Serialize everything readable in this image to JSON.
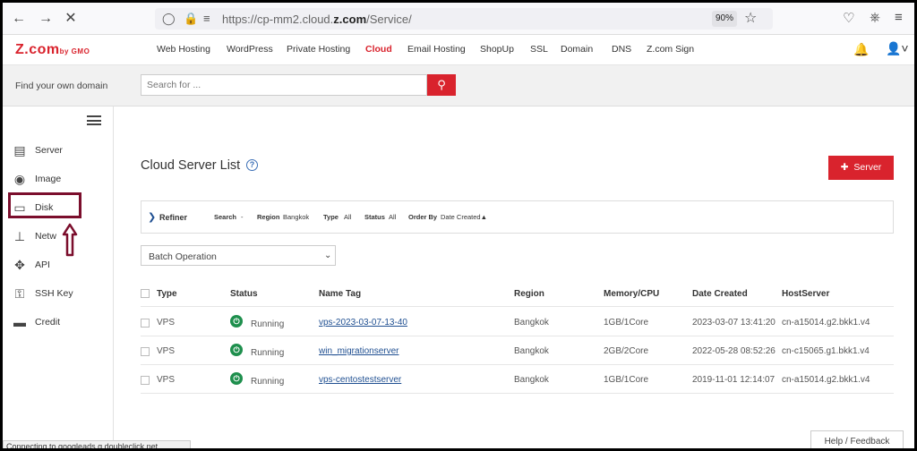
{
  "browser": {
    "url_prefix": "https://cp-mm2.cloud.",
    "url_domain": "z.com",
    "url_suffix": "/Service/",
    "zoom": "90%"
  },
  "header": {
    "logo_main": "Z.com",
    "logo_sub": "by GMO",
    "nav": [
      "WordPress",
      "Private Hosting",
      "Cloud",
      "Email Hosting",
      "ShopUp",
      "SSL",
      "Domain",
      "DNS",
      "Z.com Sign"
    ],
    "nav_first": "Web Hosting",
    "active_nav": "Cloud"
  },
  "domain_search": {
    "label": "Find your own domain",
    "placeholder": "Search for ..."
  },
  "sidebar": {
    "items": [
      {
        "label": "Server",
        "icon": "server-icon"
      },
      {
        "label": "Image",
        "icon": "globe-icon"
      },
      {
        "label": "Disk",
        "icon": "disk-icon"
      },
      {
        "label": "Netw",
        "icon": "network-icon"
      },
      {
        "label": "API",
        "icon": "api-icon"
      },
      {
        "label": "SSH Key",
        "icon": "key-icon"
      },
      {
        "label": "Credit",
        "icon": "credit-card-icon"
      }
    ],
    "highlight_color": "#7b0e2c"
  },
  "main": {
    "title": "Cloud Server List",
    "add_button": "Server",
    "refiner": {
      "label": "Refiner",
      "search_label": "Search",
      "search_value": "-",
      "region_label": "Region",
      "region_value": "Bangkok",
      "type_label": "Type",
      "type_value": "All",
      "status_label": "Status",
      "status_value": "All",
      "order_label": "Order By",
      "order_value": "Date Created▲"
    },
    "batch_operation": "Batch Operation",
    "table": {
      "headers": [
        "Type",
        "Status",
        "Name Tag",
        "Region",
        "Memory/CPU",
        "Date Created",
        "HostServer"
      ],
      "rows": [
        {
          "type": "VPS",
          "status": "Running",
          "name": "vps-2023-03-07-13-40",
          "region": "Bangkok",
          "memcpu": "1GB/1Core",
          "date": "2023-03-07 13:41:20",
          "host": "cn-a15014.g2.bkk1.v4"
        },
        {
          "type": "VPS",
          "status": "Running",
          "name": "win_migrationserver",
          "region": "Bangkok",
          "memcpu": "2GB/2Core",
          "date": "2022-05-28 08:52:26",
          "host": "cn-c15065.g1.bkk1.v4"
        },
        {
          "type": "VPS",
          "status": "Running",
          "name": "vps-centostestserver",
          "region": "Bangkok",
          "memcpu": "1GB/1Core",
          "date": "2019-11-01 12:14:07",
          "host": "cn-a15014.g2.bkk1.v4"
        }
      ]
    }
  },
  "status_bar": "Connecting to googleads.g.doubleclick.net...",
  "feedback": "Help / Feedback",
  "colors": {
    "accent": "#d9232d",
    "link": "#1f4f91",
    "running": "#1e8f4d"
  }
}
